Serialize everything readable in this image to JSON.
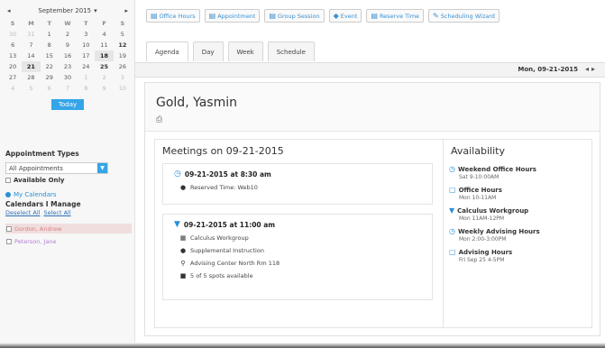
{
  "calendar": {
    "month_label": "September 2015",
    "dow": [
      "S",
      "M",
      "T",
      "W",
      "T",
      "F",
      "S"
    ],
    "weeks": [
      [
        {
          "d": "30",
          "c": "dim"
        },
        {
          "d": "31",
          "c": "dim"
        },
        {
          "d": "1",
          "c": ""
        },
        {
          "d": "2",
          "c": ""
        },
        {
          "d": "3",
          "c": ""
        },
        {
          "d": "4",
          "c": ""
        },
        {
          "d": "5",
          "c": ""
        }
      ],
      [
        {
          "d": "6",
          "c": ""
        },
        {
          "d": "7",
          "c": ""
        },
        {
          "d": "8",
          "c": ""
        },
        {
          "d": "9",
          "c": ""
        },
        {
          "d": "10",
          "c": ""
        },
        {
          "d": "11",
          "c": ""
        },
        {
          "d": "12",
          "c": "bold"
        }
      ],
      [
        {
          "d": "13",
          "c": ""
        },
        {
          "d": "14",
          "c": ""
        },
        {
          "d": "15",
          "c": ""
        },
        {
          "d": "16",
          "c": ""
        },
        {
          "d": "17",
          "c": ""
        },
        {
          "d": "18",
          "c": "sel"
        },
        {
          "d": "19",
          "c": ""
        }
      ],
      [
        {
          "d": "20",
          "c": ""
        },
        {
          "d": "21",
          "c": "sel"
        },
        {
          "d": "22",
          "c": ""
        },
        {
          "d": "23",
          "c": ""
        },
        {
          "d": "24",
          "c": ""
        },
        {
          "d": "25",
          "c": "bold"
        },
        {
          "d": "26",
          "c": ""
        }
      ],
      [
        {
          "d": "27",
          "c": ""
        },
        {
          "d": "28",
          "c": ""
        },
        {
          "d": "29",
          "c": ""
        },
        {
          "d": "30",
          "c": ""
        },
        {
          "d": "1",
          "c": "dim"
        },
        {
          "d": "2",
          "c": "dim"
        },
        {
          "d": "3",
          "c": "dim"
        }
      ],
      [
        {
          "d": "4",
          "c": "dim"
        },
        {
          "d": "5",
          "c": "dim"
        },
        {
          "d": "6",
          "c": "dim"
        },
        {
          "d": "7",
          "c": "dim"
        },
        {
          "d": "8",
          "c": "dim"
        },
        {
          "d": "9",
          "c": "dim"
        },
        {
          "d": "10",
          "c": "dim"
        }
      ]
    ],
    "today_label": "Today"
  },
  "sidebar": {
    "appointment_types_title": "Appointment Types",
    "appointment_select_value": "All Appointments",
    "available_only_label": "Available Only",
    "my_calendars_label": "My Calendars",
    "calendars_manage_title": "Calendars I Manage",
    "deselect_all_label": "Deselect All",
    "select_all_label": "Select All",
    "calendar_items": [
      "Gordon, Andrew",
      "Peterson, Jane"
    ]
  },
  "toolbar": {
    "buttons": [
      "Office Hours",
      "Appointment",
      "Group Session",
      "Event",
      "Reserve Time",
      "Scheduling Wizard"
    ]
  },
  "tabs": [
    "Agenda",
    "Day",
    "Week",
    "Schedule"
  ],
  "current_date": "Mon, 09-21-2015",
  "person_name": "Gold, Yasmin",
  "meetings": {
    "title": "Meetings on 09-21-2015",
    "items": [
      {
        "time": "09-21-2015 at 8:30 am",
        "rows": [
          "Reserved Time: Web10"
        ]
      },
      {
        "time": "09-21-2015 at 11:00 am",
        "rows": [
          "Calculus Workgroup",
          "Supplemental Instruction",
          "Advising Center North Rm 118",
          "5 of 5 spots available"
        ]
      }
    ]
  },
  "availability": {
    "title": "Availability",
    "items": [
      {
        "name": "Weekend Office Hours",
        "time": "Sat 9-10:00AM"
      },
      {
        "name": "Office Hours",
        "time": "Mon 10-11AM"
      },
      {
        "name": "Calculus Workgroup",
        "time": "Mon 11AM-12PM"
      },
      {
        "name": "Weekly Advising Hours",
        "time": "Mon 2:00-3:00PM"
      },
      {
        "name": "Advising Hours",
        "time": "Fri Sep 25 4-5PM"
      }
    ]
  }
}
